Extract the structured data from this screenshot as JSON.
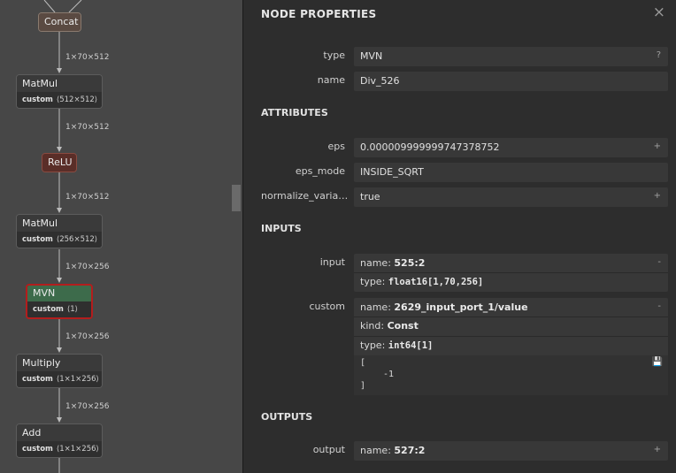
{
  "graph": {
    "nodes": [
      {
        "name": "node-concat",
        "title": "Concat"
      },
      {
        "name": "node-matmul-1",
        "title": "MatMul",
        "attr_key": "custom",
        "attr_val": "⟨512×512⟩"
      },
      {
        "name": "node-relu",
        "title": "ReLU"
      },
      {
        "name": "node-matmul-2",
        "title": "MatMul",
        "attr_key": "custom",
        "attr_val": "⟨256×512⟩"
      },
      {
        "name": "node-mvn",
        "title": "MVN",
        "attr_key": "custom",
        "attr_val": "⟨1⟩"
      },
      {
        "name": "node-multiply",
        "title": "Multiply",
        "attr_key": "custom",
        "attr_val": "⟨1×1×256⟩"
      },
      {
        "name": "node-add",
        "title": "Add",
        "attr_key": "custom",
        "attr_val": "⟨1×1×256⟩"
      }
    ],
    "edge_labels": [
      "1×70×512",
      "1×70×512",
      "1×70×512",
      "1×70×256",
      "1×70×256",
      "1×70×256"
    ]
  },
  "panel": {
    "title": "NODE PROPERTIES",
    "close_icon": "×",
    "type_label": "type",
    "type_value": "MVN",
    "type_action": "?",
    "name_label": "name",
    "name_value": "Div_526",
    "attributes_header": "ATTRIBUTES",
    "attributes": [
      {
        "label": "eps",
        "value": "0.000009999999747378752",
        "action": "+"
      },
      {
        "label": "eps_mode",
        "value": "INSIDE_SQRT",
        "action": ""
      },
      {
        "label": "normalize_varia…",
        "value": "true",
        "action": "+"
      }
    ],
    "inputs_header": "INPUTS",
    "input": {
      "label": "input",
      "name_key": "name: ",
      "name_val": "525:2",
      "type_key": "type: ",
      "type_val": "float16[1,70,256]",
      "action": "-"
    },
    "custom": {
      "label": "custom",
      "name_key": "name: ",
      "name_val": "2629_input_port_1/value",
      "kind_key": "kind: ",
      "kind_val": "Const",
      "type_key": "type: ",
      "type_val": "int64[1]",
      "code_l1": "[",
      "code_l2": "-1",
      "code_l3": "]",
      "action": "-",
      "save_icon": "💾"
    },
    "outputs_header": "OUTPUTS",
    "output": {
      "label": "output",
      "name_key": "name: ",
      "name_val": "527:2",
      "action": "+"
    }
  },
  "colors": {
    "graph_bg": "#474747",
    "panel_bg": "#2d2d2d",
    "mvn_header": "#3d6b4b",
    "mvn_border": "#b31d1d",
    "relu_bg": "#5a2e28",
    "concat_bg": "#5a4a42"
  }
}
